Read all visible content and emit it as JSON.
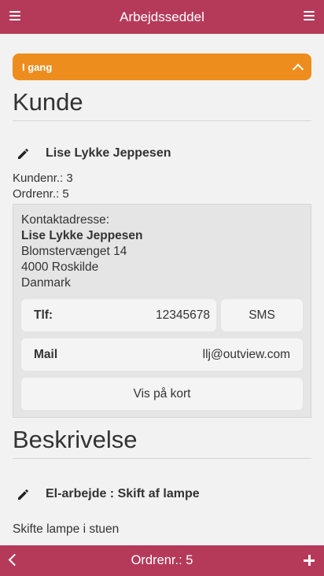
{
  "header": {
    "title": "Arbejdsseddel",
    "left_icon": "menu-icon",
    "right_icon": "menu-icon"
  },
  "status": {
    "label": "I gang",
    "icon": "chevron-up-icon",
    "color": "#ed8d1e"
  },
  "customer_section": {
    "heading": "Kunde",
    "customer_name": "Lise Lykke Jeppesen",
    "customer_no": "Kundenr.: 3",
    "order_no": "Ordrenr.: 5",
    "contact": {
      "label": "Kontaktadresse:",
      "name": "Lise Lykke Jeppesen",
      "street": "Blomstervænget 14",
      "city": "4000 Roskilde",
      "country": "Danmark",
      "phone_label": "Tlf:",
      "phone_value": "12345678",
      "sms_label": "SMS",
      "mail_label": "Mail",
      "mail_value": "llj@outview.com",
      "map_label": "Vis på kort"
    }
  },
  "description_section": {
    "heading": "Beskrivelse",
    "title": "El-arbejde : Skift af lampe",
    "text": "Skifte lampe i stuen"
  },
  "footer": {
    "title": "Ordrenr.: 5",
    "left_icon": "chevron-left-icon",
    "right_icon": "plus-icon"
  },
  "colors": {
    "brand": "#b53a5a",
    "status": "#ed8d1e",
    "background": "#f2f2f2"
  }
}
